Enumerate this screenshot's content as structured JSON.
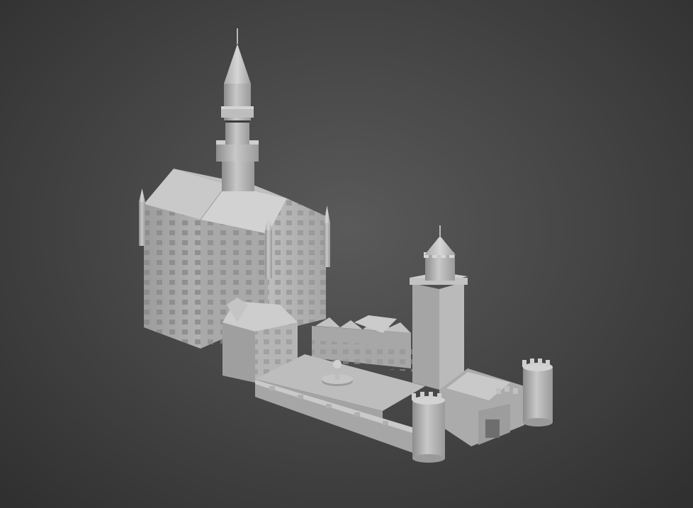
{
  "scene": {
    "subject": "castle-3d-model",
    "render_style": "untextured-gray-shaded",
    "background_color": "#3e3e3e",
    "model_color": "#b4b4b4"
  }
}
